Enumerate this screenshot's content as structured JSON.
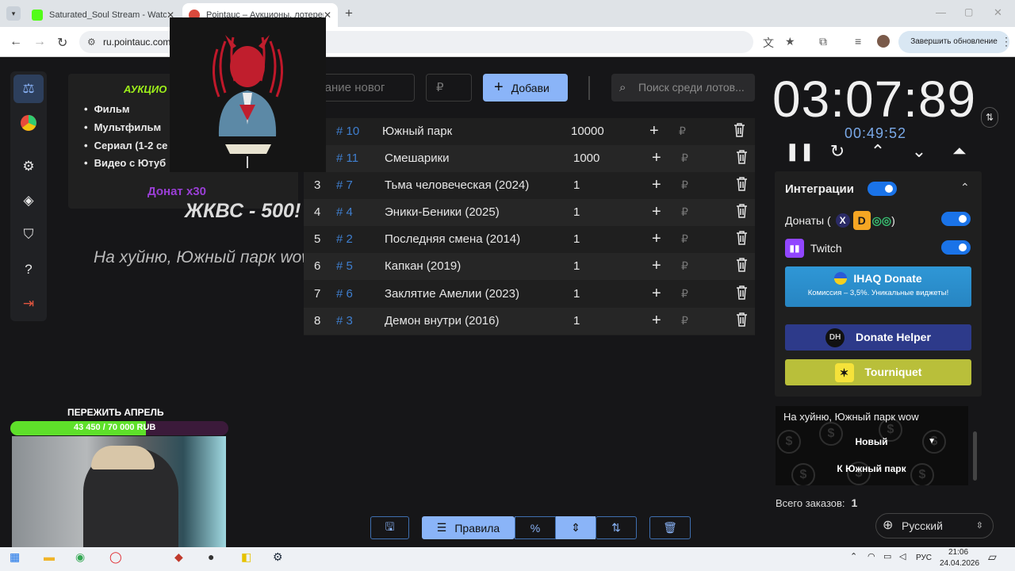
{
  "browser": {
    "tabs": [
      {
        "title": "Saturated_Soul Stream - Watch",
        "favicon_color": "#1b1b1b"
      },
      {
        "title": "Pointauc – Аукционы, лотереи",
        "favicon_color": "#d94a3d"
      }
    ],
    "url": "ru.pointauc.com",
    "update_button": "Завершить обновление"
  },
  "sidebar": {
    "items": [
      "auction-icon",
      "wheel-icon",
      "settings-icon",
      "layers-icon",
      "shield-icon",
      "help-icon",
      "logout-icon"
    ]
  },
  "info": {
    "title": "АУКЦИО",
    "items": [
      "Фильм",
      "Мультфильм",
      "Сериал (1-2 се",
      "Видео с Ютуб"
    ],
    "donat": "Донат x30"
  },
  "overlay": {
    "big": "ЖКВС  - 500!",
    "small": "На хуйню, Южный парк wow"
  },
  "toolbar": {
    "new_lot_placeholder": "звание новог",
    "amount_placeholder": "₽",
    "add_label": "Добави",
    "search_placeholder": "Поиск среди лотов..."
  },
  "lots": [
    {
      "num": "",
      "id": "# 10",
      "name": "Южный парк",
      "amount": "10000"
    },
    {
      "num": "",
      "id": "# 11",
      "name": "Смешарики",
      "amount": "1000"
    },
    {
      "num": "3",
      "id": "# 7",
      "name": "Тьма человеческая (2024)",
      "amount": "1"
    },
    {
      "num": "4",
      "id": "# 4",
      "name": "Эники-Беники (2025)",
      "amount": "1"
    },
    {
      "num": "5",
      "id": "# 2",
      "name": "Последняя смена (2014)",
      "amount": "1"
    },
    {
      "num": "6",
      "id": "# 5",
      "name": "Капкан (2019)",
      "amount": "1"
    },
    {
      "num": "7",
      "id": "# 6",
      "name": "Заклятие Амелии (2023)",
      "amount": "1"
    },
    {
      "num": "8",
      "id": "# 3",
      "name": "Демон внутри (2016)",
      "amount": "1"
    }
  ],
  "currency_symbol": "₽",
  "timer": {
    "main": "03:07:89",
    "sub": "00:49:52"
  },
  "integrations": {
    "title": "Интеграции",
    "donations_label": "Донаты (",
    "donations_label_end": ")",
    "twitch_label": "Twitch",
    "ihaq_title": "IHAQ Donate",
    "ihaq_sub": "Комиссия – 3,5%. Уникальные виджеты!",
    "donate_helper": "Donate Helper",
    "donate_helper_icon_text": "DH",
    "tourniquet": "Tourniquet"
  },
  "donation_widget": {
    "message": "На хуйню, Южный парк wow",
    "select_value": "Новый",
    "button": "К Южный парк"
  },
  "orders": {
    "label": "Всего заказов:",
    "count": "1"
  },
  "language": "Русский",
  "bottom_bar": {
    "rules_label": "Правила"
  },
  "stream": {
    "goal_title": "ПЕРЕЖИТЬ АПРЕЛЬ",
    "goal_text": "43 450 / 70 000 RUB",
    "goal_progress": 0.6207
  },
  "taskbar": {
    "lang": "РУС",
    "time": "21:06",
    "date": "24.04.2026"
  },
  "colors": {
    "accent": "#8ab4f8",
    "toggle": "#1a73e8",
    "goal_fill": "#5ee02a",
    "ihaq": "#2a8fd0",
    "donate_helper": "#2d3a8a",
    "tourniquet": "#b9bf3a"
  }
}
